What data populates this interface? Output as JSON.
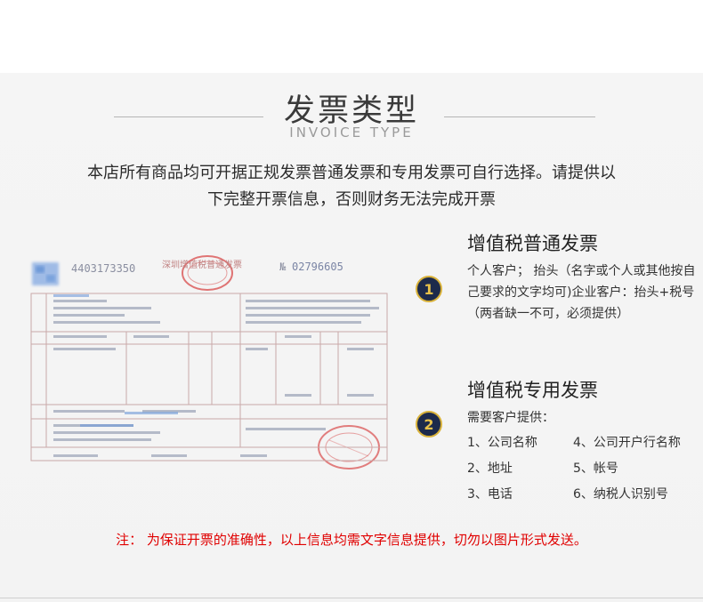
{
  "header": {
    "title": "发票类型",
    "subtitle": "INVOICE TYPE"
  },
  "intro": {
    "line1": "本店所有商品均可开据正规发票普通发票和专用发票可自行选择。请提供以",
    "line2": "下完整开票信息，否则财务无法完成开票"
  },
  "invoice_image": {
    "code": "4403173350",
    "header_text": "深圳增值税普通发票",
    "number_label": "№",
    "number": "02796605"
  },
  "sections": [
    {
      "badge": "1",
      "title": "增值税普通发票",
      "body": "个人客户；  抬头（名字或个人或其他按自己要求的文字均可)企业客户：抬头+税号（两者缺一不可，必须提供）"
    },
    {
      "badge": "2",
      "title": "增值税专用发票",
      "lead": "需要客户提供：",
      "items": [
        "1、公司名称",
        "4、公司开户行名称",
        "2、地址",
        "5、帐号",
        "3、电话",
        "6、纳税人识别号"
      ]
    }
  ],
  "note": "注：  为保证开票的准确性，以上信息均需文字信息提供，切勿以图片形式发送。",
  "colors": {
    "badge_fill": "#1d2a4b",
    "badge_ring": "#d9b23a",
    "note_red": "#e00000",
    "stamp_red": "#d84a4a",
    "form_blue": "#5a8fd8"
  }
}
